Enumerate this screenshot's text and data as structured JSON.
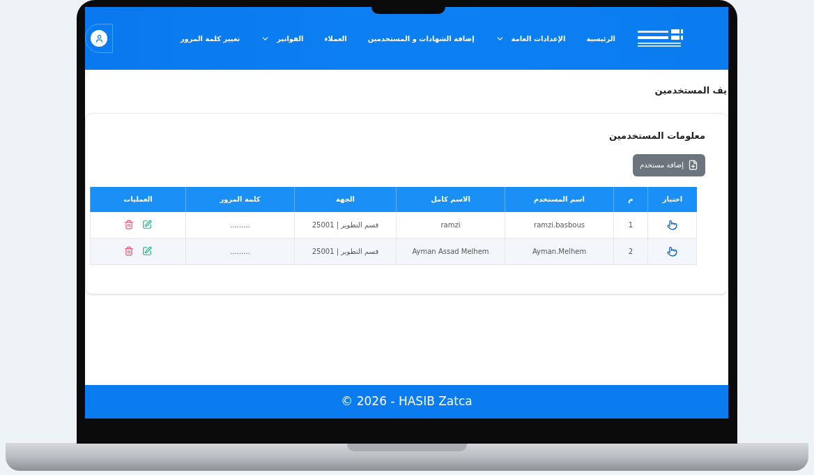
{
  "header": {
    "nav": [
      {
        "label": "الرئيسية",
        "dropdown": false
      },
      {
        "label": "الإعدادات العامة",
        "dropdown": true
      },
      {
        "label": "إضافة الشهادات و المستخدمين",
        "dropdown": false
      },
      {
        "label": "العملاء",
        "dropdown": false
      },
      {
        "label": "الفواتير",
        "dropdown": true
      },
      {
        "label": "تغيير كلمة المرور",
        "dropdown": false
      }
    ]
  },
  "page_title": "يف المستخدمين",
  "card": {
    "title": "معلومات المستخدمين",
    "add_button": "إضافة مستخدم",
    "table": {
      "columns": [
        "اختيار",
        "م",
        "اسم المستخدم",
        "الاسم كامل",
        "الجهة",
        "كلمة المرور",
        "العمليات"
      ],
      "rows": [
        {
          "index": "1",
          "username": "ramzi.basbous",
          "full_name": "ramzi",
          "department": "قسم التطوير | 25001",
          "password": "........."
        },
        {
          "index": "2",
          "username": "Ayman.Melhem",
          "full_name": "Ayman Assad Melhem",
          "department": "قسم التطوير | 25001",
          "password": "........."
        }
      ]
    }
  },
  "footer": "© 2026 - HASIB Zatca"
}
